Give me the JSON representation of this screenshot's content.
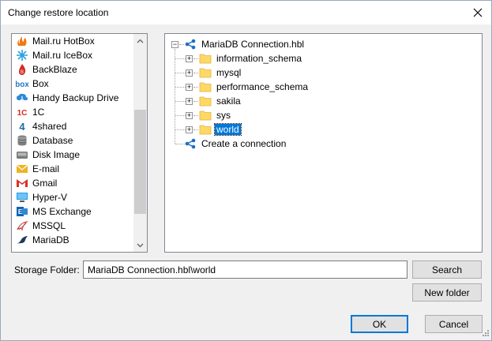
{
  "window": {
    "title": "Change restore location"
  },
  "left_list": {
    "items": [
      {
        "label": "Mail.ru HotBox",
        "icon": "mailru-hotbox-icon"
      },
      {
        "label": "Mail.ru IceBox",
        "icon": "mailru-icebox-icon"
      },
      {
        "label": "BackBlaze",
        "icon": "backblaze-icon"
      },
      {
        "label": "Box",
        "icon": "box-icon"
      },
      {
        "label": "Handy Backup Drive",
        "icon": "handy-backup-drive-icon"
      },
      {
        "label": "1C",
        "icon": "1c-icon"
      },
      {
        "label": "4shared",
        "icon": "4shared-icon"
      },
      {
        "label": "Database",
        "icon": "database-icon"
      },
      {
        "label": "Disk Image",
        "icon": "disk-image-icon"
      },
      {
        "label": "E-mail",
        "icon": "email-icon"
      },
      {
        "label": "Gmail",
        "icon": "gmail-icon"
      },
      {
        "label": "Hyper-V",
        "icon": "hyper-v-icon"
      },
      {
        "label": "MS Exchange",
        "icon": "ms-exchange-icon"
      },
      {
        "label": "MSSQL",
        "icon": "mssql-icon"
      },
      {
        "label": "MariaDB",
        "icon": "mariadb-icon"
      }
    ],
    "selected": "MariaDB"
  },
  "tree": {
    "root": "MariaDB Connection.hbl",
    "children": [
      "information_schema",
      "mysql",
      "performance_schema",
      "sakila",
      "sys",
      "world"
    ],
    "selected": "world",
    "create_connection": "Create a connection",
    "expander_minus": "−",
    "expander_plus": "+"
  },
  "storage": {
    "label": "Storage Folder:",
    "value": "MariaDB Connection.hbl\\world"
  },
  "buttons": {
    "search": "Search",
    "new_folder": "New folder",
    "ok": "OK",
    "cancel": "Cancel"
  },
  "colors": {
    "selection": "#0078d7",
    "dialog_bg": "#f0f0f0",
    "folder": "#ffd866"
  }
}
